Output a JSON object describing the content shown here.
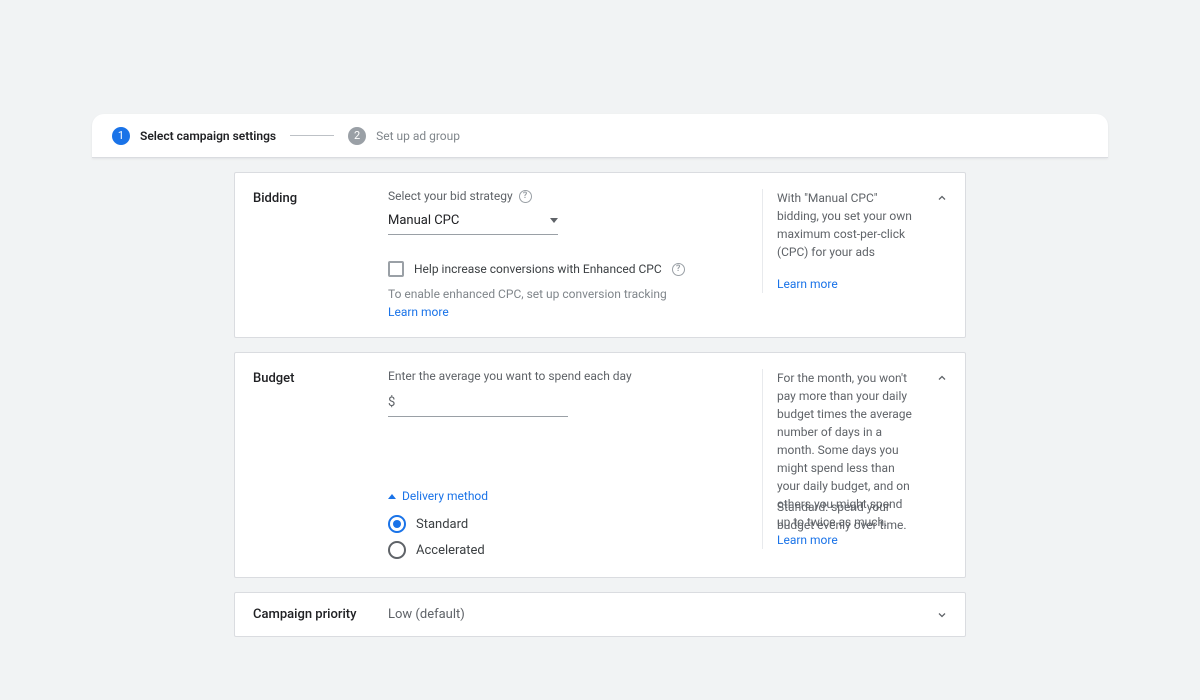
{
  "stepper": {
    "step1_num": "1",
    "step1_label": "Select campaign settings",
    "step2_num": "2",
    "step2_label": "Set up ad group"
  },
  "bidding": {
    "title": "Bidding",
    "strategy_label": "Select your bid strategy",
    "strategy_value": "Manual CPC",
    "enhance_label": "Help increase conversions with Enhanced CPC",
    "enable_hint": "To enable enhanced CPC, set up conversion tracking",
    "learn_more": "Learn more",
    "aside_text": "With \"Manual CPC\" bidding, you set your own maximum cost-per-click (CPC) for your ads",
    "aside_link": "Learn more"
  },
  "budget": {
    "title": "Budget",
    "enter_label": "Enter the average you want to spend each day",
    "currency_symbol": "$",
    "delivery_label": "Delivery method",
    "radio_standard": "Standard",
    "radio_accelerated": "Accelerated",
    "aside_text": "For the month, you won't pay more than your daily budget times the average number of days in a month. Some days you might spend less than your daily budget, and on others you might spend up to twice as much.",
    "aside_link": "Learn more",
    "aside2_text": "Standard: spend your budget evenly over time."
  },
  "priority": {
    "title": "Campaign priority",
    "value": "Low (default)"
  }
}
